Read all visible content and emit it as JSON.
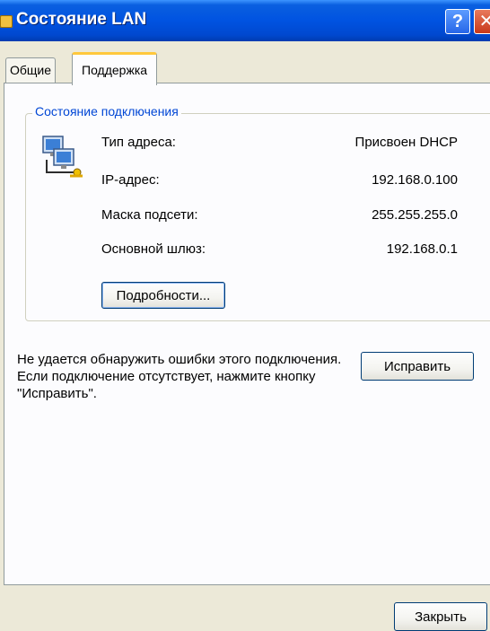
{
  "window": {
    "title": "Состояние LAN",
    "help_glyph": "?",
    "close_glyph": "✕"
  },
  "tabs": [
    {
      "label": "Общие",
      "active": false
    },
    {
      "label": "Поддержка",
      "active": true
    }
  ],
  "connection_status": {
    "group_title": "Состояние подключения",
    "icon": "network-connection-icon",
    "rows": [
      {
        "label": "Тип адреса:",
        "value": "Присвоен DHCP"
      },
      {
        "label": "IP-адрес:",
        "value": "192.168.0.100"
      },
      {
        "label": "Маска подсети:",
        "value": "255.255.255.0"
      },
      {
        "label": "Основной шлюз:",
        "value": "192.168.0.1"
      }
    ],
    "details_button": "Подробности..."
  },
  "repair": {
    "message": "Не удается обнаружить ошибки этого подключения. Если подключение отсутствует, нажмите кнопку \"Исправить\".",
    "button": "Исправить"
  },
  "footer": {
    "close_button": "Закрыть"
  },
  "colors": {
    "titlebar": "#0053e1",
    "dialog_bg": "#ece9d8",
    "group_title": "#0046d5",
    "active_tab_highlight": "#ffc83c"
  }
}
